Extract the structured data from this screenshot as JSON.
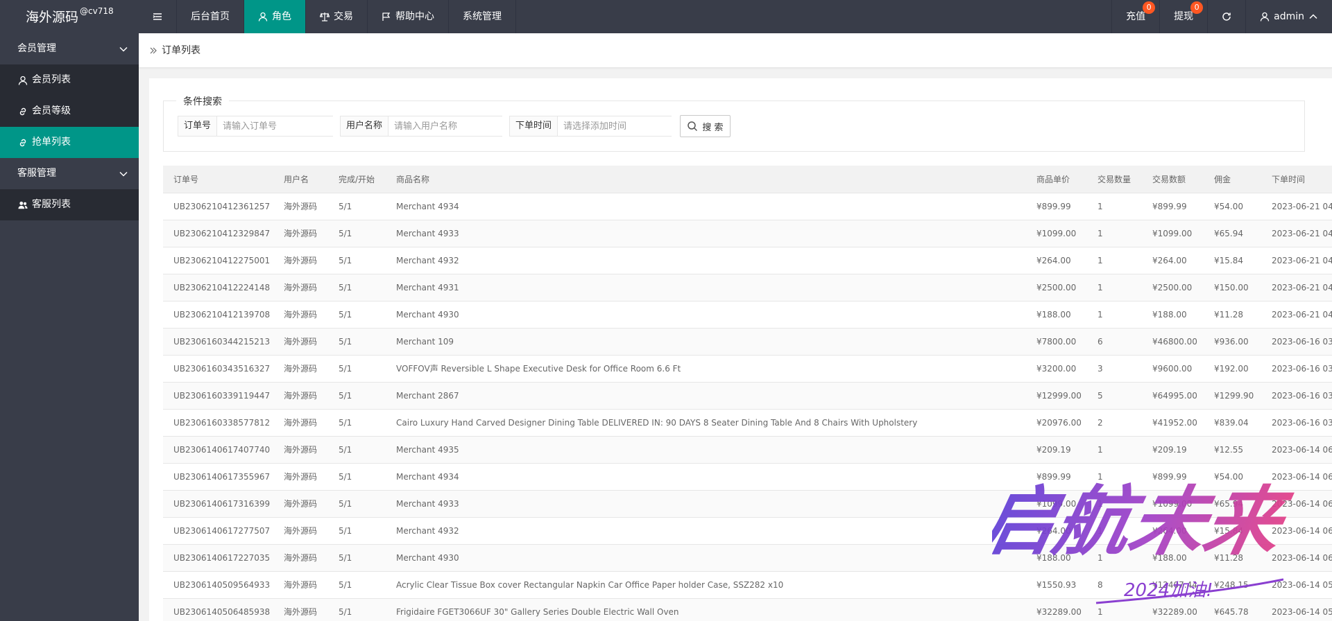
{
  "logo": {
    "text": "海外源码",
    "sub": "@cv718"
  },
  "nav": {
    "items": [
      {
        "label": "后台首页",
        "icon": "home"
      },
      {
        "label": "角色",
        "icon": "user-icon",
        "active": true
      },
      {
        "label": "交易",
        "icon": "scale-icon"
      },
      {
        "label": "帮助中心",
        "icon": "flag-icon"
      },
      {
        "label": "系统管理",
        "icon": ""
      }
    ],
    "right": {
      "recharge": {
        "label": "充值",
        "badge": "0"
      },
      "withdraw": {
        "label": "提现",
        "badge": "0"
      },
      "user": "admin"
    }
  },
  "sidebar": {
    "group1": "会员管理",
    "items1": [
      "会员列表",
      "会员等级",
      "抢单列表"
    ],
    "group2": "客服管理",
    "items2": [
      "客服列表"
    ]
  },
  "breadcrumb": "订单列表",
  "search": {
    "legend": "条件搜索",
    "order_label": "订单号",
    "order_placeholder": "请输入订单号",
    "user_label": "用户名称",
    "user_placeholder": "请输入用户名称",
    "time_label": "下单时间",
    "time_placeholder": "请选择添加时间",
    "button": "搜 索"
  },
  "table": {
    "headers": [
      "订单号",
      "用户名",
      "完成/开始",
      "商品名称",
      "商品单价",
      "交易数量",
      "交易数额",
      "佣金",
      "下单时间"
    ],
    "rows": [
      [
        "UB2306210412361257",
        "海外源码",
        "5/1",
        "Merchant 4934",
        "¥899.99",
        "1",
        "¥899.99",
        "¥54.00",
        "2023-06-21 04"
      ],
      [
        "UB2306210412329847",
        "海外源码",
        "5/1",
        "Merchant 4933",
        "¥1099.00",
        "1",
        "¥1099.00",
        "¥65.94",
        "2023-06-21 04"
      ],
      [
        "UB2306210412275001",
        "海外源码",
        "5/1",
        "Merchant 4932",
        "¥264.00",
        "1",
        "¥264.00",
        "¥15.84",
        "2023-06-21 04"
      ],
      [
        "UB2306210412224148",
        "海外源码",
        "5/1",
        "Merchant 4931",
        "¥2500.00",
        "1",
        "¥2500.00",
        "¥150.00",
        "2023-06-21 04"
      ],
      [
        "UB2306210412139708",
        "海外源码",
        "5/1",
        "Merchant 4930",
        "¥188.00",
        "1",
        "¥188.00",
        "¥11.28",
        "2023-06-21 04"
      ],
      [
        "UB2306160344215213",
        "海外源码",
        "5/1",
        "Merchant 109",
        "¥7800.00",
        "6",
        "¥46800.00",
        "¥936.00",
        "2023-06-16 03"
      ],
      [
        "UB2306160343516327",
        "海外源码",
        "5/1",
        "VOFFOV声 Reversible L Shape Executive Desk for Office Room 6.6 Ft",
        "¥3200.00",
        "3",
        "¥9600.00",
        "¥192.00",
        "2023-06-16 03"
      ],
      [
        "UB2306160339119447",
        "海外源码",
        "5/1",
        "Merchant 2867",
        "¥12999.00",
        "5",
        "¥64995.00",
        "¥1299.90",
        "2023-06-16 03"
      ],
      [
        "UB2306160338577812",
        "海外源码",
        "5/1",
        "Cairo Luxury Hand Carved Designer Dining Table DELIVERED IN: 90 DAYS 8 Seater Dining Table And 8 Chairs With Upholstery",
        "¥20976.00",
        "2",
        "¥41952.00",
        "¥839.04",
        "2023-06-16 03"
      ],
      [
        "UB2306140617407740",
        "海外源码",
        "5/1",
        "Merchant 4935",
        "¥209.19",
        "1",
        "¥209.19",
        "¥12.55",
        "2023-06-14 06"
      ],
      [
        "UB2306140617355967",
        "海外源码",
        "5/1",
        "Merchant 4934",
        "¥899.99",
        "1",
        "¥899.99",
        "¥54.00",
        "2023-06-14 06"
      ],
      [
        "UB2306140617316399",
        "海外源码",
        "5/1",
        "Merchant 4933",
        "¥1099.00",
        "1",
        "¥1099.00",
        "¥65.94",
        "2023-06-14 06"
      ],
      [
        "UB2306140617277507",
        "海外源码",
        "5/1",
        "Merchant 4932",
        "¥264.00",
        "1",
        "¥264.00",
        "¥15.84",
        "2023-06-14 06"
      ],
      [
        "UB2306140617227035",
        "海外源码",
        "5/1",
        "Merchant 4930",
        "¥188.00",
        "1",
        "¥188.00",
        "¥11.28",
        "2023-06-14 06"
      ],
      [
        "UB2306140509564933",
        "海外源码",
        "5/1",
        "Acrylic Clear Tissue Box cover Rectangular Napkin Car Office Paper holder Case, SSZ282 x10",
        "¥1550.93",
        "8",
        "¥12407.44",
        "¥248.15",
        "2023-06-14 05"
      ],
      [
        "UB2306140506485938",
        "海外源码",
        "5/1",
        "Frigidaire FGET3066UF 30\" Gallery Series Double Electric Wall Oven",
        "¥32289.00",
        "1",
        "¥32289.00",
        "¥645.78",
        "2023-06-14 05"
      ]
    ]
  },
  "watermark": {
    "main": "启航未来",
    "sub": "2024加油!"
  },
  "colors": {
    "header": "#393d49",
    "accent": "#009688",
    "badge": "#ff5722",
    "submenu": "#282b33"
  }
}
